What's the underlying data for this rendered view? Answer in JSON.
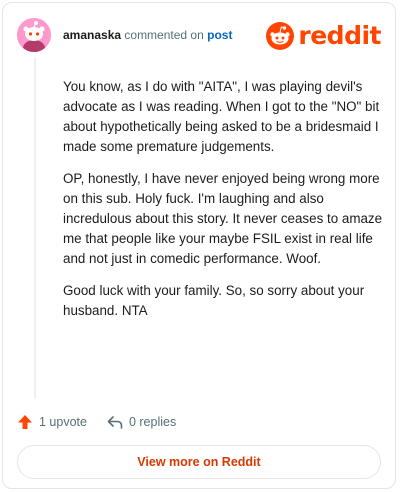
{
  "header": {
    "username": "amanaska",
    "action_text": "commented on",
    "post_link": "post",
    "logo_text": "reddit",
    "avatar_icon": "snoo-avatar-icon"
  },
  "comment": {
    "paragraphs": [
      "You know, as I do with \"AITA\", I was playing devil's advocate as I was reading. When I got to the \"NO\" bit about hypothetically being asked to be a bridesmaid I made some premature judgements.",
      "OP, honestly, I have never enjoyed being wrong more on this sub. Holy fuck. I'm laughing and also incredulous about this story. It never ceases to amaze me that people like your maybe FSIL exist in real life and not just in comedic performance. Woof.",
      "Good luck with your family. So, so sorry about your husband. NTA"
    ]
  },
  "actions": {
    "upvote_label": "1 upvote",
    "replies_label": "0 replies"
  },
  "footer": {
    "button_label": "View more on Reddit"
  },
  "colors": {
    "brand": "#ff4500",
    "link": "#0a65c0",
    "avatar_bg": "#ff99cc",
    "button_text": "#d93900"
  }
}
